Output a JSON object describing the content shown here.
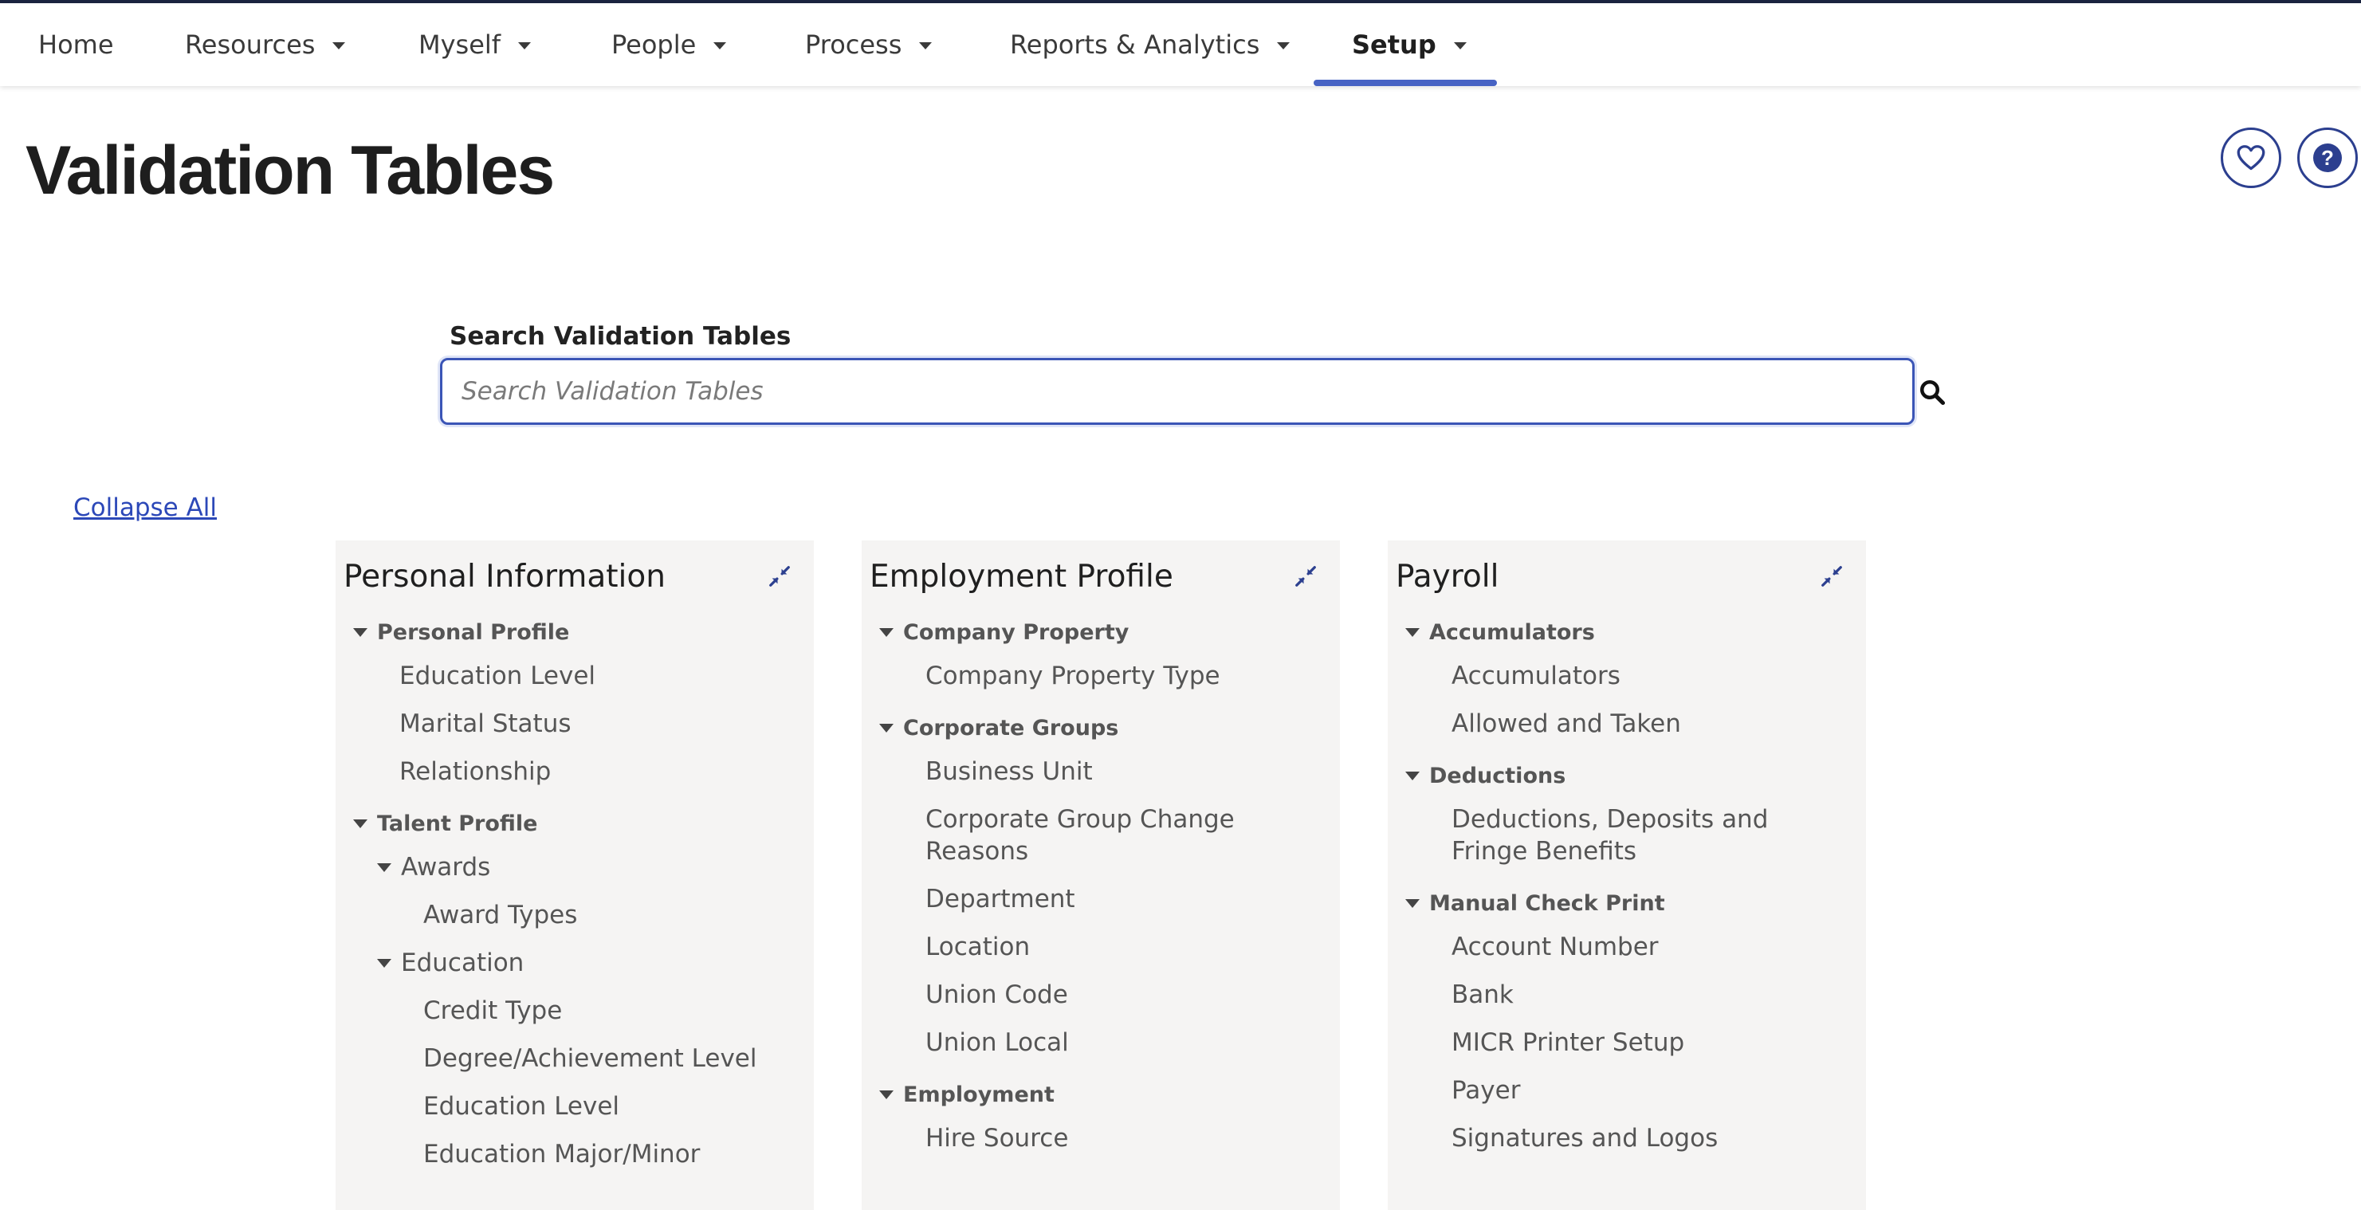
{
  "nav": {
    "items": [
      {
        "label": "Home",
        "dropdown": false
      },
      {
        "label": "Resources",
        "dropdown": true
      },
      {
        "label": "Myself",
        "dropdown": true
      },
      {
        "label": "People",
        "dropdown": true
      },
      {
        "label": "Process",
        "dropdown": true
      },
      {
        "label": "Reports & Analytics",
        "dropdown": true
      },
      {
        "label": "Setup",
        "dropdown": true,
        "active": true
      }
    ]
  },
  "page": {
    "title": "Validation Tables"
  },
  "search": {
    "label": "Search Validation Tables",
    "placeholder": "Search Validation Tables",
    "value": ""
  },
  "collapse_all_label": "Collapse All",
  "panels": [
    {
      "title": "Personal Information",
      "groups": [
        {
          "label": "Personal Profile",
          "items": [
            "Education Level",
            "Marital Status",
            "Relationship"
          ]
        },
        {
          "label": "Talent Profile",
          "subgroups": [
            {
              "label": "Awards",
              "items": [
                "Award Types"
              ]
            },
            {
              "label": "Education",
              "items": [
                "Credit Type",
                "Degree/Achievement Level",
                "Education Level",
                "Education Major/Minor"
              ]
            }
          ]
        }
      ]
    },
    {
      "title": "Employment Profile",
      "groups": [
        {
          "label": "Company Property",
          "items": [
            "Company Property Type"
          ]
        },
        {
          "label": "Corporate Groups",
          "items": [
            "Business Unit",
            "Corporate Group Change Reasons",
            "Department",
            "Location",
            "Union Code",
            "Union Local"
          ]
        },
        {
          "label": "Employment",
          "items": [
            "Hire Source"
          ]
        }
      ]
    },
    {
      "title": "Payroll",
      "groups": [
        {
          "label": "Accumulators",
          "items": [
            "Accumulators",
            "Allowed and Taken"
          ]
        },
        {
          "label": "Deductions",
          "items": [
            "Deductions, Deposits and Fringe Benefits"
          ]
        },
        {
          "label": "Manual Check Print",
          "items": [
            "Account Number",
            "Bank",
            "MICR Printer Setup",
            "Payer",
            "Signatures and Logos"
          ]
        }
      ]
    }
  ],
  "icons": {
    "favorite": "heart-icon",
    "help": "help-icon",
    "search": "search-icon",
    "collapse": "collapse-icon"
  },
  "colors": {
    "accent": "#3b55b6",
    "nav_underline": "#4763c4",
    "panel_bg": "#f5f4f3",
    "link": "#2c48b8"
  }
}
